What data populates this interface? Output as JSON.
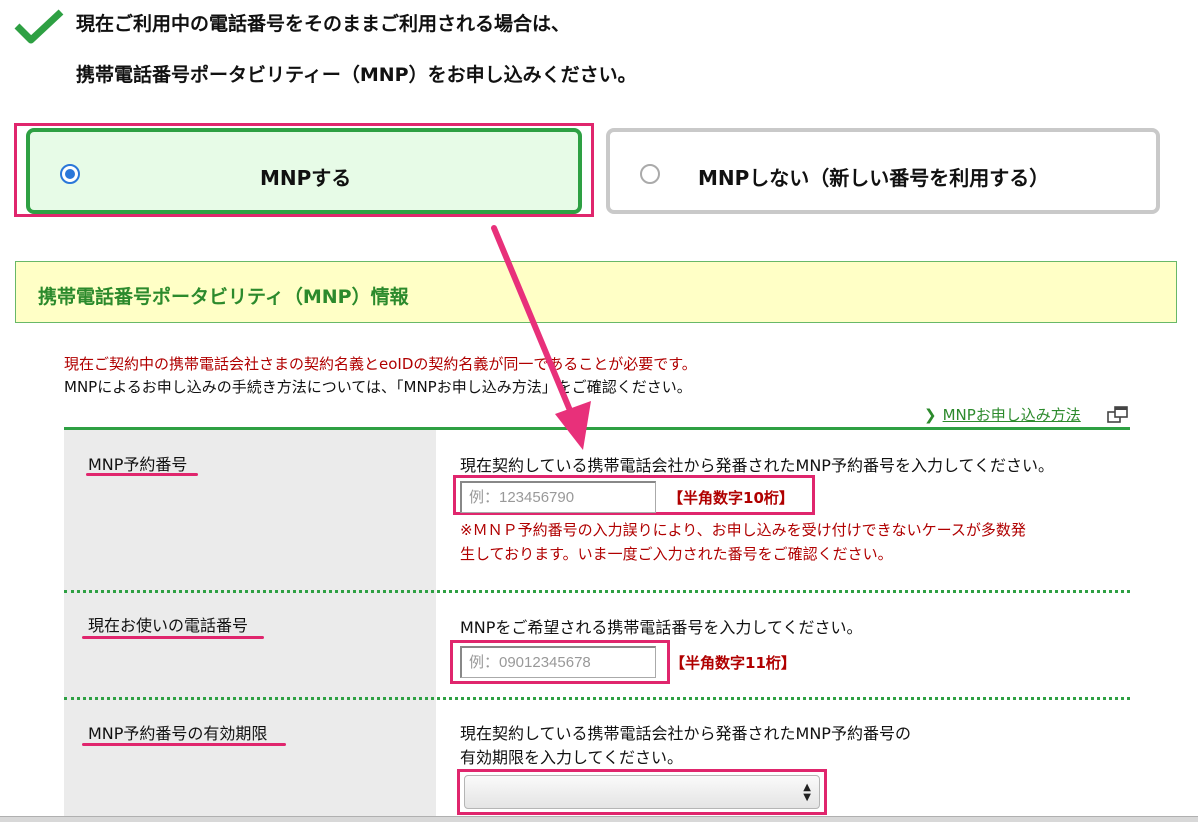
{
  "intro": {
    "line1": "現在ご利用中の電話番号をそのままご利用される場合は、",
    "line2": "携帯電話番号ポータビリティー（MNP）をお申し込みください。"
  },
  "options": {
    "yes_label": "MNPする",
    "no_label": "MNPしない（新しい番号を利用する）",
    "selected": "yes"
  },
  "section": {
    "title": "携帯電話番号ポータビリティ（MNP）情報",
    "note_red": "現在ご契約中の携帯電話会社さまの契約名義とeoIDの契約名義が同一であることが必要です。",
    "note_black": "MNPによるお申し込みの手続き方法については、「MNPお申し込み方法」をご確認ください。",
    "link_label": "MNPお申し込み方法"
  },
  "rows": {
    "reservation": {
      "label": "MNP予約番号",
      "description": "現在契約している携帯電話会社から発番されたMNP予約番号を入力してください。",
      "placeholder": "例：123456790",
      "hint": "【半角数字10桁】",
      "warning_line1": "※ＭＮＰ予約番号の入力誤りにより、お申し込みを受け付けできないケースが多数発",
      "warning_line2": "生しております。いま一度ご入力された番号をご確認ください。"
    },
    "phone": {
      "label": "現在お使いの電話番号",
      "description": "MNPをご希望される携帯電話番号を入力してください。",
      "placeholder": "例：09012345678",
      "hint": "【半角数字11桁】"
    },
    "expiry": {
      "label": "MNP予約番号の有効期限",
      "description_line1": "現在契約している携帯電話会社から発番されたMNP予約番号の",
      "description_line2": "有効期限を入力してください。",
      "selected_value": ""
    }
  },
  "icons": {
    "intro": "checkmark-icon",
    "link_chevron": "chevron-right-icon",
    "external": "external-window-icon",
    "select": "select-arrows-icon"
  },
  "colors": {
    "accent_green": "#2ea043",
    "highlight_pink": "#e0266d",
    "warning_red": "#b00000",
    "section_bg": "#ffffc6",
    "selected_option_bg": "#e7fbe7"
  }
}
